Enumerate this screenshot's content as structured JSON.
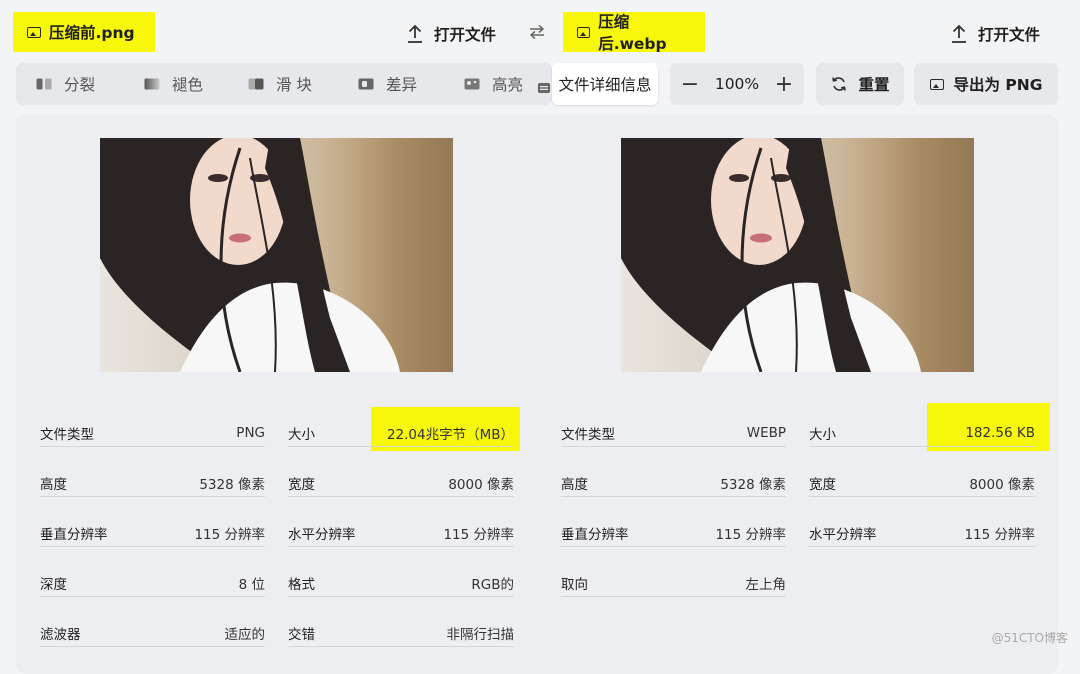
{
  "left_file": {
    "title": "压缩前.png",
    "open_label": "打开文件"
  },
  "right_file": {
    "title": "压缩后.webp",
    "open_label": "打开文件"
  },
  "toolbar": {
    "modes": [
      {
        "label": "分裂",
        "icon": "split-icon"
      },
      {
        "label": "褪色",
        "icon": "fade-icon"
      },
      {
        "label": "滑 块",
        "icon": "slider-icon"
      },
      {
        "label": "差异",
        "icon": "difference-icon"
      },
      {
        "label": "高亮",
        "icon": "highlight-icon"
      }
    ],
    "details_label": "文件详细信息",
    "zoom": {
      "minus": "−",
      "value": "100%",
      "plus": "+"
    },
    "reset_label": "重置",
    "export_label": "导出为 PNG"
  },
  "left_info": {
    "col1": [
      {
        "label": "文件类型",
        "value": "PNG"
      },
      {
        "label": "高度",
        "value": "5328 像素"
      },
      {
        "label": "垂直分辨率",
        "value": "115 分辨率"
      },
      {
        "label": "深度",
        "value": "8 位"
      },
      {
        "label": "滤波器",
        "value": "适应的"
      }
    ],
    "col2": [
      {
        "label": "大小",
        "value": "22.04兆字节（MB）"
      },
      {
        "label": "宽度",
        "value": "8000 像素"
      },
      {
        "label": "水平分辨率",
        "value": "115 分辨率"
      },
      {
        "label": "格式",
        "value": "RGB的"
      },
      {
        "label": "交错",
        "value": "非隔行扫描"
      }
    ]
  },
  "right_info": {
    "col1": [
      {
        "label": "文件类型",
        "value": "WEBP"
      },
      {
        "label": "高度",
        "value": "5328 像素"
      },
      {
        "label": "垂直分辨率",
        "value": "115 分辨率"
      },
      {
        "label": "取向",
        "value": "左上角"
      }
    ],
    "col2": [
      {
        "label": "大小",
        "value": "182.56 KB"
      },
      {
        "label": "宽度",
        "value": "8000 像素"
      },
      {
        "label": "水平分辨率",
        "value": "115 分辨率"
      }
    ]
  },
  "watermark": "@51CTO博客",
  "colors": {
    "highlight": "#f7f70b",
    "panel": "#eceef1",
    "page": "#f3f4f6"
  }
}
